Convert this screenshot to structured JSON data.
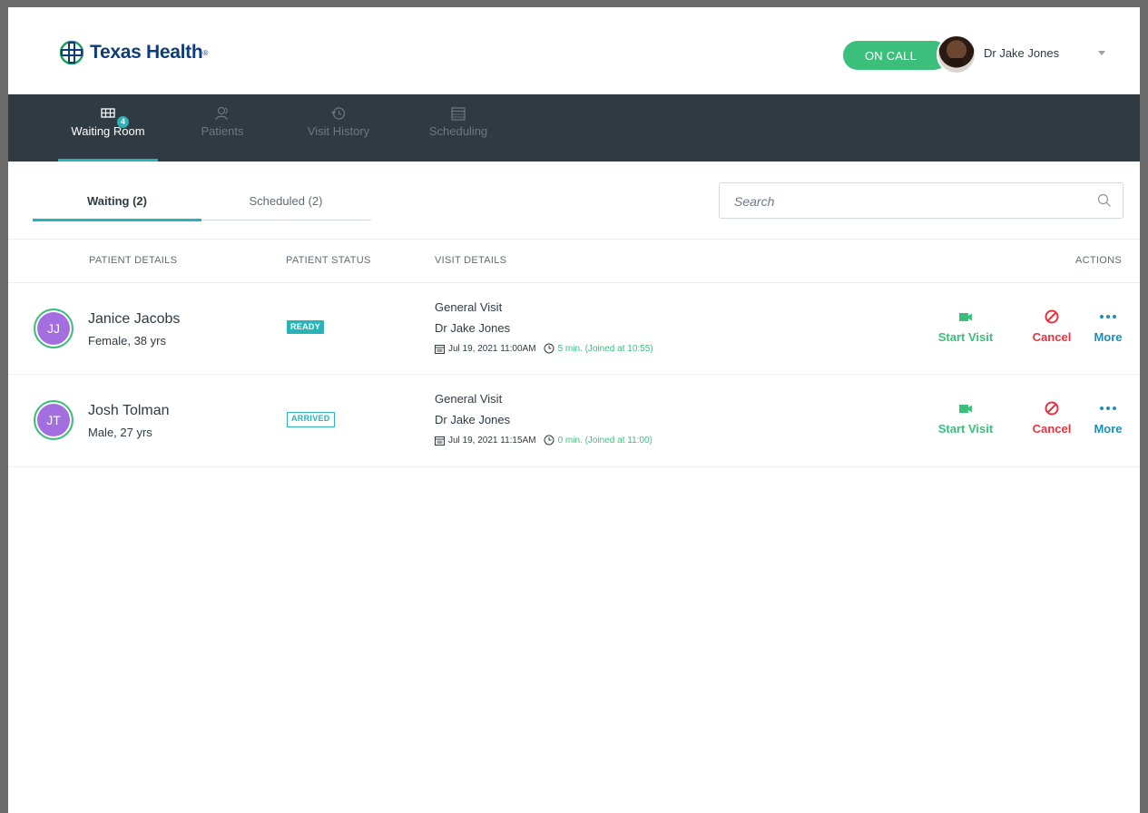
{
  "brand": {
    "name": "Texas Health",
    "reg": "®",
    "color": "#0f3d7a"
  },
  "header": {
    "on_call_label": "ON CALL",
    "user_name": "Dr Jake Jones"
  },
  "nav": {
    "items": [
      {
        "label": "Waiting Room",
        "icon": "waiting-room-icon",
        "badge": "4",
        "active": true
      },
      {
        "label": "Patients",
        "icon": "patients-icon"
      },
      {
        "label": "Visit History",
        "icon": "history-icon"
      },
      {
        "label": "Scheduling",
        "icon": "calendar-icon"
      }
    ]
  },
  "tabs": [
    {
      "label": "Waiting (2)",
      "active": true
    },
    {
      "label": "Scheduled (2)"
    }
  ],
  "search": {
    "placeholder": "Search"
  },
  "table": {
    "headers": {
      "patient_details": "PATIENT DETAILS",
      "patient_status": "PATIENT STATUS",
      "visit_details": "VISIT DETAILS",
      "actions": "ACTIONS"
    },
    "rows": [
      {
        "initials": "JJ",
        "name": "Janice Jacobs",
        "meta": "Female, 38 yrs",
        "status": "READY",
        "visit_type": "General Visit",
        "doctor": "Dr Jake Jones",
        "datetime": "Jul 19, 2021 11:00AM",
        "wait": "5 min. (Joined at 10:55)",
        "actions": {
          "start": "Start Visit",
          "cancel": "Cancel",
          "more": "More"
        }
      },
      {
        "initials": "JT",
        "name": "Josh Tolman",
        "meta": "Male, 27 yrs",
        "status": "ARRIVED",
        "visit_type": "General Visit",
        "doctor": "Dr Jake Jones",
        "datetime": "Jul 19, 2021 11:15AM",
        "wait": "0 min. (Joined at 11:00)",
        "actions": {
          "start": "Start Visit",
          "cancel": "Cancel",
          "more": "More"
        }
      }
    ]
  },
  "colors": {
    "accent": "#27b3b8",
    "success": "#3dbf7c",
    "danger": "#e8323f",
    "link": "#1a8fb8",
    "nav_bg": "#2f3a42",
    "avatar": "#a26ee0"
  }
}
